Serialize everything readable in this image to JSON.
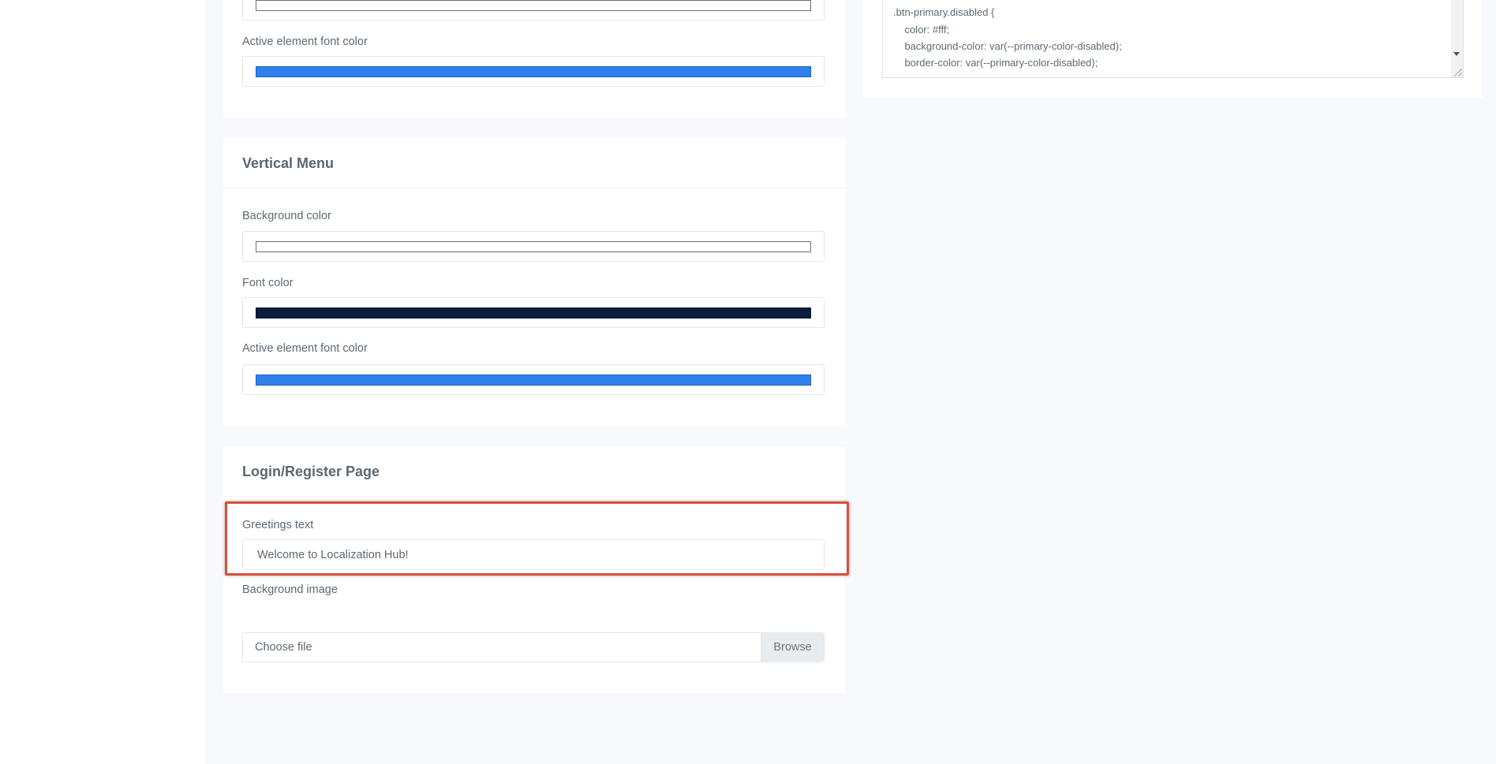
{
  "top_card": {
    "active_font_label": "Active element font color",
    "swatch_top_color": "#ffffff",
    "active_font_color": "#2f80ed"
  },
  "vertical_menu": {
    "title": "Vertical Menu",
    "background_label": "Background color",
    "background_color": "#ffffff",
    "font_label": "Font color",
    "font_color": "#0b1a3d",
    "active_font_label": "Active element font color",
    "active_font_color": "#2f80ed"
  },
  "login_register": {
    "title": "Login/Register Page",
    "greetings_label": "Greetings text",
    "greetings_value": "Welcome to Localization Hub!",
    "background_image_label": "Background image",
    "file_placeholder": "Choose file",
    "browse_label": "Browse"
  },
  "css_editor": {
    "lines": [
      ".btn-primary.disabled {",
      "    color: #fff;",
      "    background-color: var(--primary-color-disabled);",
      "    border-color: var(--primary-color-disabled);"
    ]
  },
  "colors": {
    "highlight_border": "#d8503c",
    "page_background": "#f8f9fc"
  }
}
